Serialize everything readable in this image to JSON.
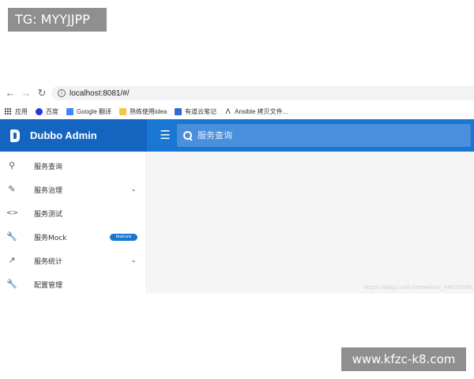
{
  "overlays": {
    "top_watermark": "TG: MYYJJPP",
    "bottom_watermark": "www.kfzc-k8.com"
  },
  "browser": {
    "nav": {
      "back_icon": "arrow-left-icon",
      "forward_icon": "arrow-right-icon",
      "reload_icon": "reload-icon"
    },
    "url": "localhost:8081/#/",
    "bookmarks": [
      {
        "label": "应用",
        "icon": "apps-grid-icon",
        "color": "#4a4a4a"
      },
      {
        "label": "百度",
        "icon": "baidu-paw-icon",
        "color": "#2932e1"
      },
      {
        "label": "Google 翻译",
        "icon": "google-translate-icon",
        "color": "#4285f4"
      },
      {
        "label": "熟练使用idea",
        "icon": "folder-icon",
        "color": "#f6c342"
      },
      {
        "label": "有道云笔记",
        "icon": "youdao-note-icon",
        "color": "#2f6bd8"
      },
      {
        "label": "Ansible 拷贝文件...",
        "icon": "ansible-icon",
        "color": "#1a1a1a"
      }
    ]
  },
  "app": {
    "brand": "Dubbo Admin",
    "menu_icon": "hamburger-menu-icon",
    "search_placeholder": "服务查询",
    "colors": {
      "header": "#1976d2",
      "brand_bg": "#1565c0",
      "search_bg": "#4a8fdb",
      "badge": "#1976d2"
    },
    "sidebar": [
      {
        "label": "服务查询",
        "icon": "search-icon",
        "expandable": false
      },
      {
        "label": "服务治理",
        "icon": "pencil-icon",
        "expandable": true
      },
      {
        "label": "服务测试",
        "icon": "code-brackets-icon",
        "expandable": false
      },
      {
        "label": "服务Mock",
        "icon": "wrench-icon",
        "expandable": false,
        "badge": "feature"
      },
      {
        "label": "服务统计",
        "icon": "trending-icon",
        "expandable": true
      },
      {
        "label": "配置管理",
        "icon": "wrench-icon",
        "expandable": false
      }
    ],
    "main_watermark": "https://blog.csdn.net/weixin_44625589"
  }
}
